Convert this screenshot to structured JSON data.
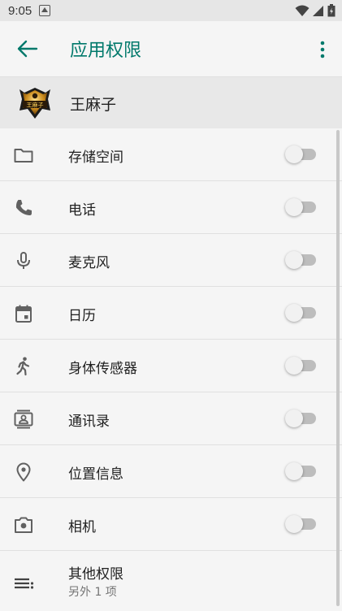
{
  "status_bar": {
    "time": "9:05"
  },
  "app_bar": {
    "title": "应用权限"
  },
  "app": {
    "name": "王麻子",
    "icon_text": "王麻子"
  },
  "permissions": [
    {
      "label": "存储空间",
      "icon": "folder-icon",
      "enabled": false
    },
    {
      "label": "电话",
      "icon": "phone-icon",
      "enabled": false
    },
    {
      "label": "麦克风",
      "icon": "microphone-icon",
      "enabled": false
    },
    {
      "label": "日历",
      "icon": "calendar-icon",
      "enabled": false
    },
    {
      "label": "身体传感器",
      "icon": "walking-person-icon",
      "enabled": false
    },
    {
      "label": "通讯录",
      "icon": "contacts-icon",
      "enabled": false
    },
    {
      "label": "位置信息",
      "icon": "location-pin-icon",
      "enabled": false
    },
    {
      "label": "相机",
      "icon": "camera-icon",
      "enabled": false
    }
  ],
  "other": {
    "label": "其他权限",
    "sub": "另外 1 项",
    "icon": "list-icon"
  },
  "colors": {
    "accent": "#00796b",
    "icon": "#616161",
    "toggle_track": "#bdbdbd"
  }
}
